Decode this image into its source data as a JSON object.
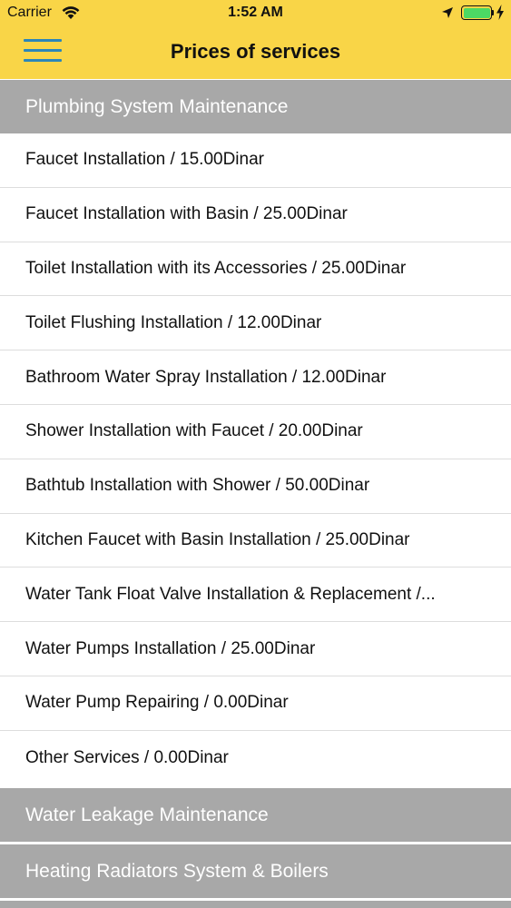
{
  "status_bar": {
    "carrier": "Carrier",
    "time": "1:52 AM"
  },
  "nav": {
    "title": "Prices of services",
    "menu_icon": "hamburger-menu-icon"
  },
  "colors": {
    "header_bg": "#f9d547",
    "section_bg": "#a8a8a8",
    "menu_icon": "#2c86b8",
    "battery": "#4cd964"
  },
  "sections": [
    {
      "title": "Plumbing System Maintenance",
      "expanded": true,
      "items": [
        "Faucet Installation / 15.00Dinar",
        "Faucet Installation with Basin / 25.00Dinar",
        "Toilet Installation with its Accessories  / 25.00Dinar",
        "Toilet Flushing Installation  / 12.00Dinar",
        "Bathroom Water Spray Installation  / 12.00Dinar",
        "Shower Installation with Faucet / 20.00Dinar",
        "Bathtub Installation with Shower / 50.00Dinar",
        "Kitchen Faucet with Basin Installation  / 25.00Dinar",
        "Water Tank Float Valve Installation & Replacement  /...",
        "Water Pumps Installation / 25.00Dinar",
        "Water Pump Repairing / 0.00Dinar",
        "Other Services  / 0.00Dinar"
      ]
    },
    {
      "title": "Water Leakage Maintenance",
      "expanded": false
    },
    {
      "title": "Heating Radiators System & Boilers",
      "expanded": false
    },
    {
      "title": "",
      "expanded": false
    }
  ]
}
